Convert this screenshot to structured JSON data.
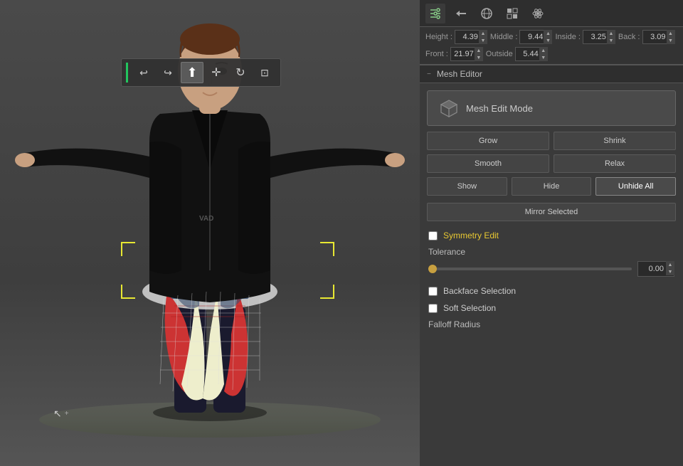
{
  "viewport": {
    "bg_color": "#4a4a4a"
  },
  "toolbar": {
    "buttons": [
      {
        "id": "undo",
        "symbol": "↩",
        "label": "undo",
        "active": false
      },
      {
        "id": "redo",
        "symbol": "↪",
        "label": "redo",
        "active": false
      },
      {
        "id": "select",
        "symbol": "↖",
        "label": "select",
        "active": true
      },
      {
        "id": "move",
        "symbol": "✛",
        "label": "move",
        "active": false
      },
      {
        "id": "rotate",
        "symbol": "↻",
        "label": "rotate",
        "active": false
      },
      {
        "id": "more",
        "symbol": "⊡",
        "label": "more",
        "active": false
      }
    ]
  },
  "panel": {
    "tabs": [
      {
        "id": "filter",
        "symbol": "≡",
        "label": "filter-tab",
        "active": true
      },
      {
        "id": "arrows",
        "symbol": "⇄",
        "label": "arrows-tab"
      },
      {
        "id": "globe",
        "symbol": "⊕",
        "label": "globe-tab"
      },
      {
        "id": "checker",
        "symbol": "◫",
        "label": "checker-tab"
      },
      {
        "id": "atom",
        "symbol": "⊛",
        "label": "atom-tab"
      }
    ],
    "measurements": {
      "height_label": "Height :",
      "height_value": "4.39",
      "middle_label": "Middle :",
      "middle_value": "9.44",
      "inside_label": "Inside :",
      "inside_value": "3.25",
      "back_label": "Back :",
      "back_value": "3.09",
      "front_label": "Front :",
      "front_value": "21.97",
      "outside_label": "Outside",
      "outside_value": "5.44"
    },
    "mesh_editor": {
      "section_title": "Mesh Editor",
      "collapse_symbol": "−",
      "edit_mode_label": "Mesh Edit Mode",
      "grow_label": "Grow",
      "shrink_label": "Shrink",
      "smooth_label": "Smooth",
      "relax_label": "Relax",
      "show_label": "Show",
      "hide_label": "Hide",
      "unhide_all_label": "Unhide All",
      "mirror_selected_label": "Mirror Selected",
      "symmetry_edit_label": "Symmetry Edit",
      "tolerance_label": "Tolerance",
      "tolerance_value": "0.00",
      "backface_selection_label": "Backface Selection",
      "soft_selection_label": "Soft Selection",
      "falloff_radius_label": "Falloff Radius"
    }
  },
  "cursor": {
    "symbol": "↖"
  }
}
